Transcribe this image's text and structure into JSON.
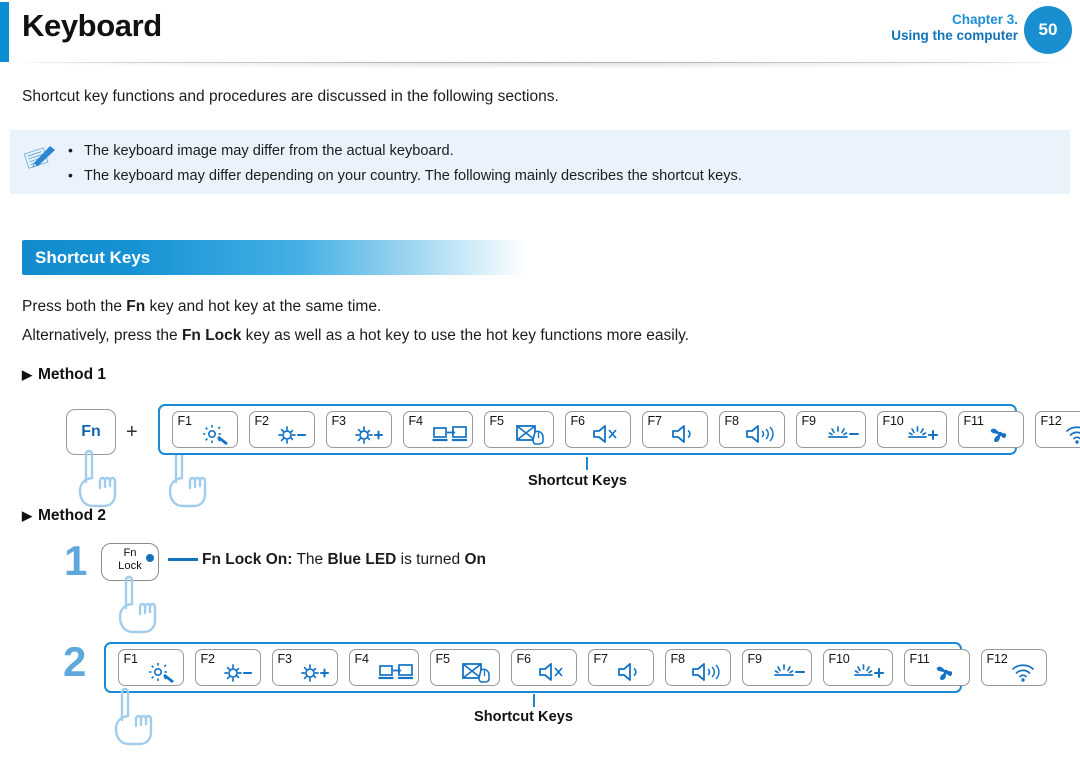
{
  "header": {
    "title": "Keyboard",
    "chapter_line1": "Chapter 3.",
    "chapter_line2": "Using the computer",
    "page_number": "50",
    "accent_color": "#0b8fd3",
    "badge_color": "#1a8fd0"
  },
  "intro": "Shortcut key functions and procedures are discussed in the following sections.",
  "note": {
    "icon": "note-pen-icon",
    "bg_color": "#eaf3fb",
    "items": [
      "The keyboard image may differ from the actual keyboard.",
      "The keyboard may differ depending on your country. The following mainly describes the shortcut keys."
    ]
  },
  "section": {
    "heading": "Shortcut Keys",
    "paragraph_1_pre": "Press both the ",
    "paragraph_1_bold": "Fn",
    "paragraph_1_post": " key and hot key at the same time.",
    "paragraph_2_pre": "Alternatively, press the ",
    "paragraph_2_bold": "Fn Lock",
    "paragraph_2_post": " key as well as a hot key to use the hot key functions more easily."
  },
  "method1": {
    "bullet": "▶",
    "label": "Method 1",
    "fn_key_label": "Fn",
    "plus": "+",
    "caption": "Shortcut Keys"
  },
  "method2": {
    "bullet": "▶",
    "label": "Method 2",
    "step1_number": "1",
    "step2_number": "2",
    "fnlock_line1": "Fn",
    "fnlock_line2": "Lock",
    "led_text_pre": "",
    "led_bold_1": "Fn Lock On:",
    "led_mid_1": " The ",
    "led_bold_2": "Blue LED",
    "led_mid_2": " is turned ",
    "led_bold_3": "On",
    "caption": "Shortcut Keys"
  },
  "function_keys": [
    {
      "label": "F1",
      "icon": "settings-gear-icon",
      "function": "Settings"
    },
    {
      "label": "F2",
      "icon": "brightness-down-icon",
      "function": "Brightness Down"
    },
    {
      "label": "F3",
      "icon": "brightness-up-icon",
      "function": "Brightness Up"
    },
    {
      "label": "F4",
      "icon": "display-switch-icon",
      "function": "External Display"
    },
    {
      "label": "F5",
      "icon": "touchpad-off-icon",
      "function": "Touchpad Off"
    },
    {
      "label": "F6",
      "icon": "volume-mute-icon",
      "function": "Mute"
    },
    {
      "label": "F7",
      "icon": "volume-down-icon",
      "function": "Volume Down"
    },
    {
      "label": "F8",
      "icon": "volume-up-icon",
      "function": "Volume Up"
    },
    {
      "label": "F9",
      "icon": "keyboard-backlight-down-icon",
      "function": "Keyboard Backlight Down"
    },
    {
      "label": "F10",
      "icon": "keyboard-backlight-up-icon",
      "function": "Keyboard Backlight Up"
    },
    {
      "label": "F11",
      "icon": "fan-silent-mode-icon",
      "function": "Silent Mode"
    },
    {
      "label": "F12",
      "icon": "wireless-icon",
      "function": "Wireless"
    }
  ],
  "colors": {
    "key_frame_blue": "#1a8ad8",
    "icon_blue": "#1473c4",
    "step_number_blue": "#5fa8dc",
    "hand_blue": "#a9d4f0"
  }
}
